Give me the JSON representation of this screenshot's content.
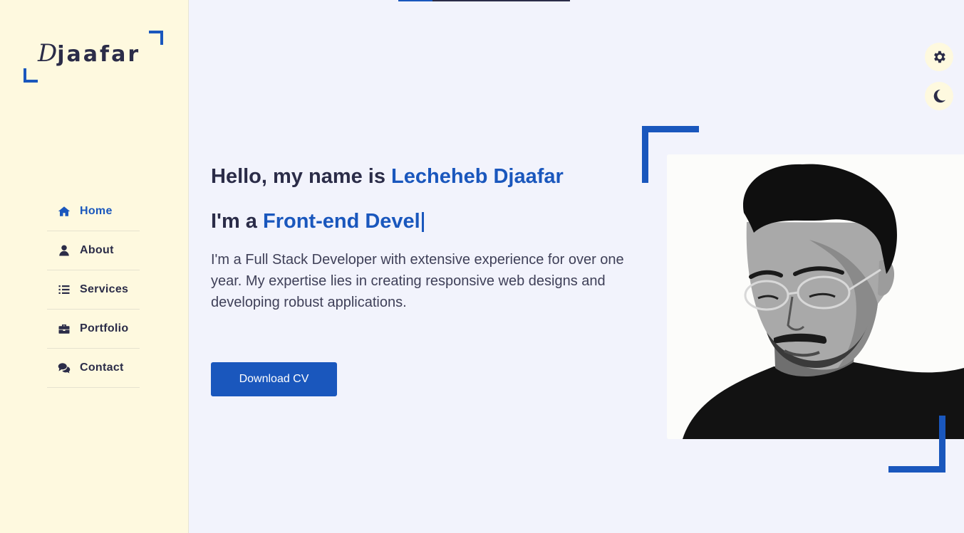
{
  "page": {
    "progress_fraction": 0.2
  },
  "brand": {
    "logo_first_letter": "D",
    "logo_rest": "jaafar"
  },
  "nav": {
    "items": [
      {
        "label": "Home",
        "icon": "home-icon",
        "active": true
      },
      {
        "label": "About",
        "icon": "user-icon",
        "active": false
      },
      {
        "label": "Services",
        "icon": "list-icon",
        "active": false
      },
      {
        "label": "Portfolio",
        "icon": "briefcase-icon",
        "active": false
      },
      {
        "label": "Contact",
        "icon": "comments-icon",
        "active": false
      }
    ]
  },
  "controls": {
    "settings_icon": "gear-icon",
    "theme_icon": "moon-icon"
  },
  "hero": {
    "greeting_prefix": "Hello, my name is ",
    "name": "Lecheheb Djaafar",
    "role_prefix": "I'm a ",
    "role_typed": "Front-end Devel",
    "description": "I'm a Full Stack Developer with extensive experience for over one year. My expertise lies in creating responsive web designs and developing robust applications.",
    "cta_label": "Download CV"
  },
  "colors": {
    "accent": "#1a57bd",
    "text_dark": "#2b2c48",
    "sidebar_bg": "#fef9df",
    "page_bg": "#f2f3fc"
  }
}
